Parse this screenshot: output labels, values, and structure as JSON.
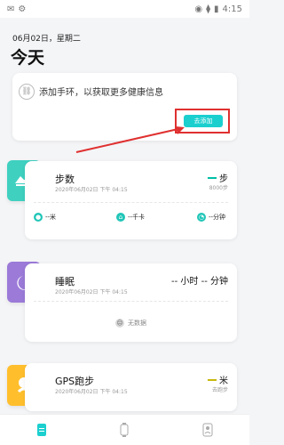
{
  "status": {
    "left_app_icons": [
      "✉",
      "⚙"
    ],
    "right_icons": [
      "◉",
      "⧫",
      "▮"
    ],
    "time": "4:15"
  },
  "header": {
    "date": "06月02日，星期二",
    "title": "今天"
  },
  "connect_card": {
    "message": "添加手环，以获取更多健康信息",
    "button_label": "去添加"
  },
  "steps": {
    "title": "步数",
    "time": "2020年06月02日 下午 04:15",
    "value": "--",
    "unit": "步",
    "target": "8000步",
    "distance": "--米",
    "calories": "--千卡",
    "duration": "--分钟"
  },
  "sleep": {
    "title": "睡眠",
    "time": "2020年06月02日 下午 04:15",
    "value": "-- 小时 -- 分钟",
    "no_data": "无数据"
  },
  "gps": {
    "title": "GPS跑步",
    "time": "2020年06月02日 下午 04:15",
    "value": "--",
    "unit": "米",
    "target": "去跑步"
  },
  "nav": {
    "items": [
      "home",
      "watch",
      "profile"
    ]
  }
}
